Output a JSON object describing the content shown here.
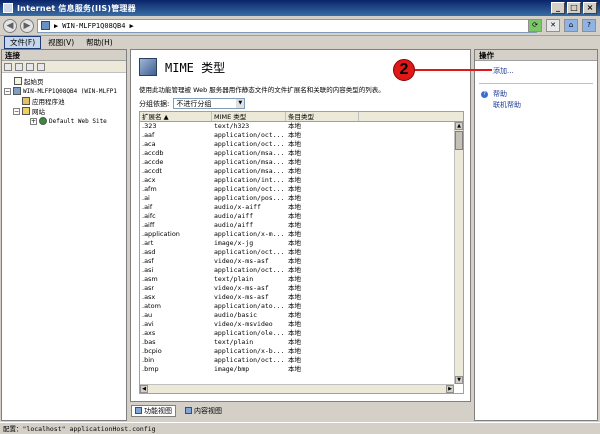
{
  "window": {
    "title": "Internet 信息服务(IIS)管理器"
  },
  "address": {
    "path": "WIN-MLFP1Q08QB4",
    "sep": "▶"
  },
  "menu": [
    {
      "label": "文件(F)",
      "active": true
    },
    {
      "label": "视图(V)"
    },
    {
      "label": "帮助(H)"
    }
  ],
  "connections": {
    "header": "连接",
    "tree": [
      {
        "label": "起始页",
        "icon": "page-icon",
        "indent": 0
      },
      {
        "label": "WIN-MLFP1Q08QB4 (WIN-MLFP1",
        "icon": "server-icon",
        "indent": 0,
        "expander": "−"
      },
      {
        "label": "应用程序池",
        "icon": "app-pool-icon",
        "indent": 1
      },
      {
        "label": "网站",
        "icon": "folder-icon",
        "indent": 1,
        "expander": "−"
      },
      {
        "label": "Default Web Site",
        "icon": "globe-icon",
        "indent": 2,
        "expander": "+"
      }
    ]
  },
  "feature": {
    "title": "MIME 类型",
    "description": "使用此功能管理被 Web 服务器用作静态文件的文件扩展名和关联的内容类型的列表。",
    "group_label": "分组依据:",
    "group_value": "不进行分组",
    "columns": [
      "扩展名 ▲",
      "MIME 类型",
      "条目类型"
    ],
    "rows": [
      [
        ".323",
        "text/h323",
        "本地"
      ],
      [
        ".aaf",
        "application/oct...",
        "本地"
      ],
      [
        ".aca",
        "application/oct...",
        "本地"
      ],
      [
        ".accdb",
        "application/msa...",
        "本地"
      ],
      [
        ".accde",
        "application/msa...",
        "本地"
      ],
      [
        ".accdt",
        "application/msa...",
        "本地"
      ],
      [
        ".acx",
        "application/int...",
        "本地"
      ],
      [
        ".afm",
        "application/oct...",
        "本地"
      ],
      [
        ".ai",
        "application/pos...",
        "本地"
      ],
      [
        ".aif",
        "audio/x-aiff",
        "本地"
      ],
      [
        ".aifc",
        "audio/aiff",
        "本地"
      ],
      [
        ".aiff",
        "audio/aiff",
        "本地"
      ],
      [
        ".application",
        "application/x-m...",
        "本地"
      ],
      [
        ".art",
        "image/x-jg",
        "本地"
      ],
      [
        ".asd",
        "application/oct...",
        "本地"
      ],
      [
        ".asf",
        "video/x-ms-asf",
        "本地"
      ],
      [
        ".asi",
        "application/oct...",
        "本地"
      ],
      [
        ".asm",
        "text/plain",
        "本地"
      ],
      [
        ".asr",
        "video/x-ms-asf",
        "本地"
      ],
      [
        ".asx",
        "video/x-ms-asf",
        "本地"
      ],
      [
        ".atom",
        "application/ato...",
        "本地"
      ],
      [
        ".au",
        "audio/basic",
        "本地"
      ],
      [
        ".avi",
        "video/x-msvideo",
        "本地"
      ],
      [
        ".axs",
        "application/ole...",
        "本地"
      ],
      [
        ".bas",
        "text/plain",
        "本地"
      ],
      [
        ".bcpio",
        "application/x-b...",
        "本地"
      ],
      [
        ".bin",
        "application/oct...",
        "本地"
      ],
      [
        ".bmp",
        "image/bmp",
        "本地"
      ]
    ]
  },
  "view_tabs": [
    {
      "label": "功能视图",
      "active": true
    },
    {
      "label": "内容视图"
    }
  ],
  "actions": {
    "header": "操作",
    "add": "添加...",
    "help": "帮助",
    "online_help": "联机帮助"
  },
  "callout": {
    "number": "2"
  },
  "status": "配置：\"localhost\" applicationHost.config"
}
